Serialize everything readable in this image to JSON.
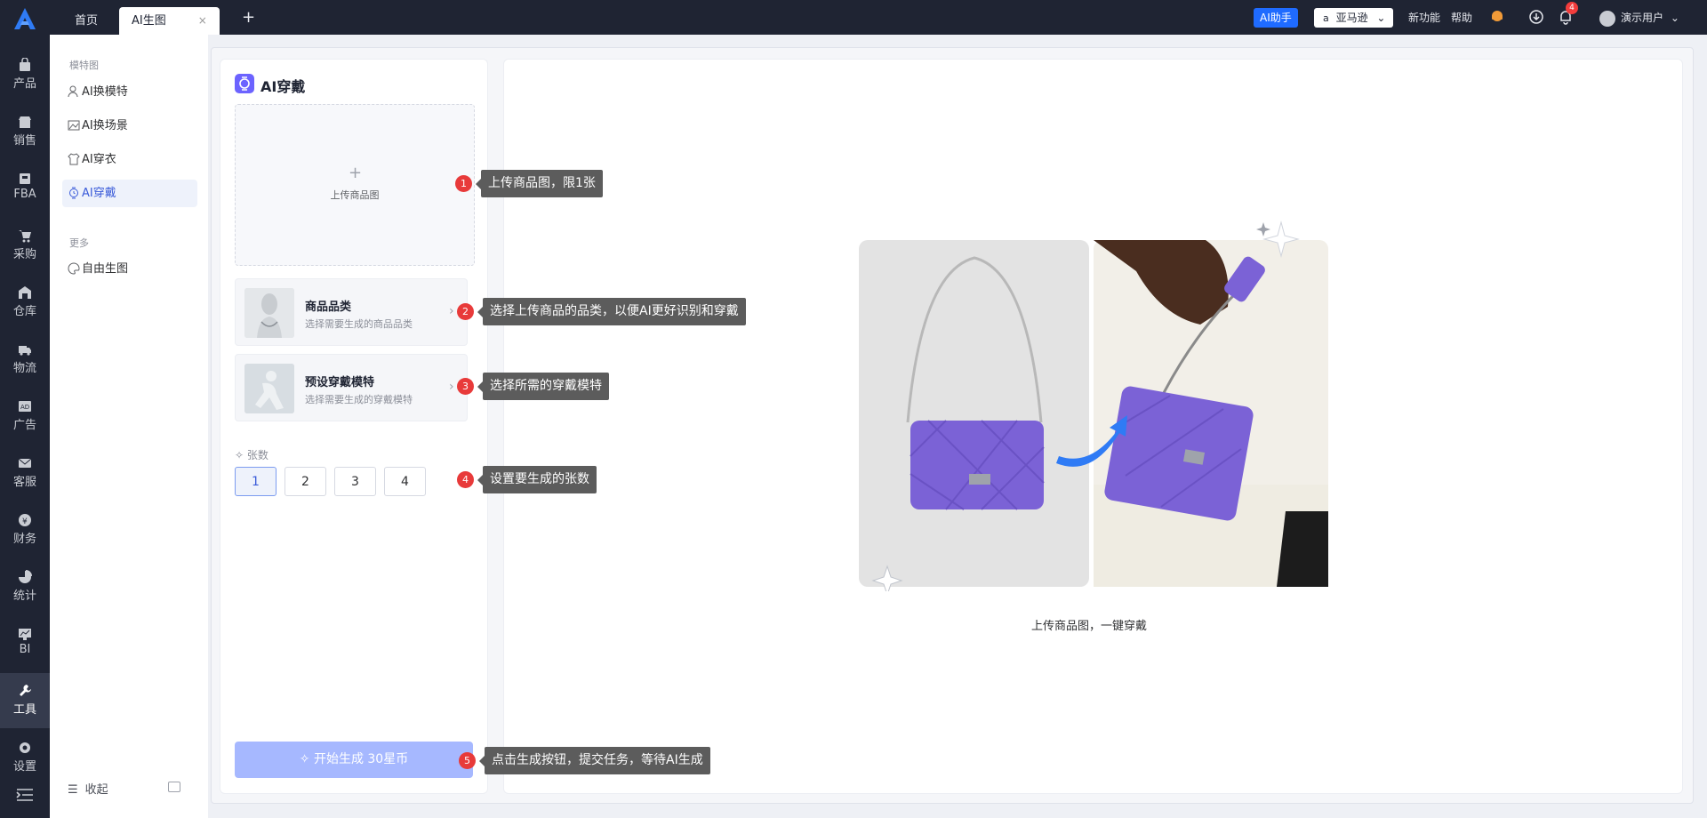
{
  "topbar": {
    "tabs": [
      {
        "label": "首页"
      },
      {
        "label": "AI生图",
        "close": "×"
      }
    ],
    "add_tab": "+",
    "ai_helper": "AI助手",
    "marketplace": "亚马逊",
    "new_features": "新功能",
    "help": "帮助",
    "notification_count": "4",
    "user_name": "演示用户"
  },
  "rail": {
    "items": [
      {
        "label": "产品",
        "icon": "bag-icon"
      },
      {
        "label": "销售",
        "icon": "shop-icon"
      },
      {
        "label": "FBA",
        "icon": "box-icon"
      },
      {
        "label": "采购",
        "icon": "cart-icon"
      },
      {
        "label": "仓库",
        "icon": "warehouse-icon"
      },
      {
        "label": "物流",
        "icon": "truck-icon"
      },
      {
        "label": "广告",
        "icon": "ad-icon"
      },
      {
        "label": "客服",
        "icon": "mail-icon"
      },
      {
        "label": "财务",
        "icon": "coin-icon"
      },
      {
        "label": "统计",
        "icon": "pie-icon"
      },
      {
        "label": "BI",
        "icon": "chart-icon"
      },
      {
        "label": "工具",
        "icon": "wrench-icon"
      },
      {
        "label": "设置",
        "icon": "gear-icon"
      }
    ],
    "active_index": 11
  },
  "sidebar": {
    "group1_title": "模特图",
    "items": [
      {
        "label": "AI换模特",
        "icon": "person-icon"
      },
      {
        "label": "AI换场景",
        "icon": "image-icon"
      },
      {
        "label": "AI穿衣",
        "icon": "shirt-icon"
      },
      {
        "label": "AI穿戴",
        "icon": "watch-icon"
      }
    ],
    "active_index": 3,
    "group2_title": "更多",
    "more_items": [
      {
        "label": "自由生图",
        "icon": "palette-icon"
      }
    ],
    "collapse_label": "收起"
  },
  "panel": {
    "title": "AI穿戴",
    "upload_plus": "+",
    "upload_label": "上传商品图",
    "category": {
      "title": "商品品类",
      "subtitle": "选择需要生成的商品品类"
    },
    "model": {
      "title": "预设穿戴模特",
      "subtitle": "选择需要生成的穿戴模特"
    },
    "count_label": "✧ 张数",
    "counts": [
      "1",
      "2",
      "3",
      "4"
    ],
    "selected_count": "1",
    "generate_label": "✧ 开始生成 30星币"
  },
  "preview": {
    "caption": "上传商品图，一键穿戴",
    "colors": {
      "bag": "#7b62d6",
      "arrow": "#2f7bf5",
      "shirt": "#efece2"
    }
  },
  "tips": [
    {
      "num": "1",
      "text": "上传商品图，限1张"
    },
    {
      "num": "2",
      "text": "选择上传商品的品类，以便AI更好识别和穿戴"
    },
    {
      "num": "3",
      "text": "选择所需的穿戴模特"
    },
    {
      "num": "4",
      "text": "设置要生成的张数"
    },
    {
      "num": "5",
      "text": "点击生成按钮，提交任务，等待AI生成"
    }
  ]
}
